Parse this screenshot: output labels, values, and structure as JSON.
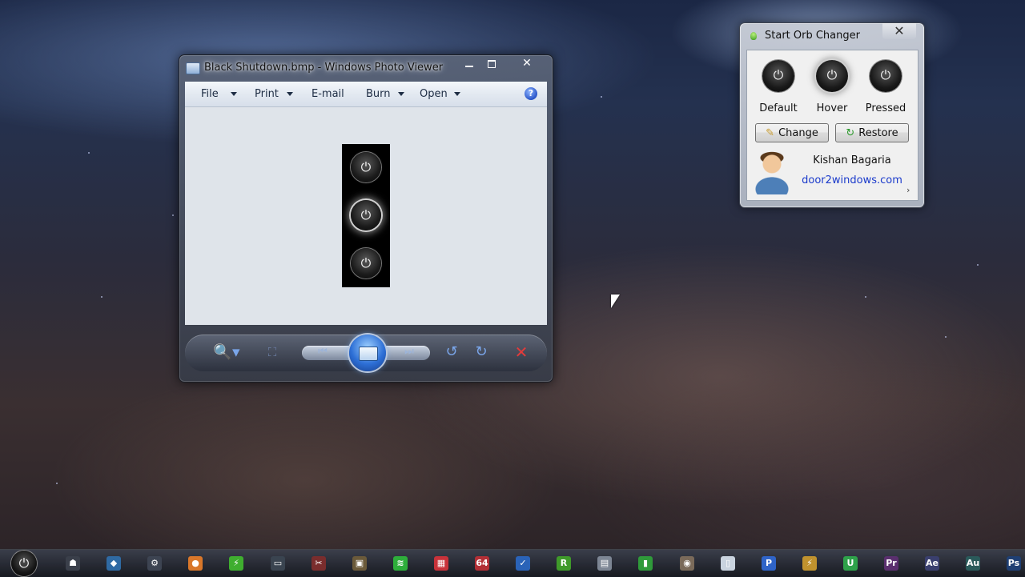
{
  "photo_viewer": {
    "title": "Black Shutdown.bmp - Windows Photo Viewer",
    "caption_buttons": {
      "minimize": "",
      "maximize": "",
      "close": "✕"
    },
    "menu": [
      {
        "label": "File",
        "has_dropdown": true
      },
      {
        "label": "Print",
        "has_dropdown": true
      },
      {
        "label": "E-mail",
        "has_dropdown": false
      },
      {
        "label": "Burn",
        "has_dropdown": true
      },
      {
        "label": "Open",
        "has_dropdown": true
      }
    ],
    "help_label": "?",
    "image_orbs": [
      "⏻",
      "⏻",
      "⏻"
    ],
    "controls": {
      "zoom": "🔍▾",
      "fit": "⛶",
      "previous": "⏮",
      "next": "⏭",
      "rotate_left": "↺",
      "rotate_right": "↻",
      "delete": "✕"
    }
  },
  "orb_changer": {
    "title": "Start Orb Changer",
    "close": "✕",
    "states": [
      {
        "label": "Default",
        "glyph": "⏻"
      },
      {
        "label": "Hover",
        "glyph": "⏻"
      },
      {
        "label": "Pressed",
        "glyph": "⏻"
      }
    ],
    "change_label": "Change",
    "restore_label": "Restore",
    "author": "Kishan Bagaria",
    "link": "door2windows.com",
    "chevron": "›"
  },
  "taskbar": {
    "start_glyph": "⏻",
    "icons": [
      {
        "name": "app-1-icon",
        "color": "#3a3f4a",
        "glyph": "☗"
      },
      {
        "name": "app-2-icon",
        "color": "#2f6aa3",
        "glyph": "◆"
      },
      {
        "name": "steam-icon",
        "color": "#3d4452",
        "glyph": "⚙"
      },
      {
        "name": "basketball-icon",
        "color": "#d9772a",
        "glyph": "●"
      },
      {
        "name": "app-5-icon",
        "color": "#3fae2f",
        "glyph": "⚡"
      },
      {
        "name": "app-6-icon",
        "color": "#3a4450",
        "glyph": "▭"
      },
      {
        "name": "app-7-icon",
        "color": "#7a2d2d",
        "glyph": "✂"
      },
      {
        "name": "app-8-icon",
        "color": "#6b5a3a",
        "glyph": "▣"
      },
      {
        "name": "app-9-icon",
        "color": "#2eae3b",
        "glyph": "≋"
      },
      {
        "name": "app-10-icon",
        "color": "#c8323a",
        "glyph": "▦"
      },
      {
        "name": "app-11-icon",
        "color": "#b22f36",
        "glyph": "64"
      },
      {
        "name": "app-12-icon",
        "color": "#2a63b8",
        "glyph": "✓"
      },
      {
        "name": "app-13-icon",
        "color": "#3f9a2a",
        "glyph": "R"
      },
      {
        "name": "app-14-icon",
        "color": "#7d8694",
        "glyph": "▤"
      },
      {
        "name": "app-15-icon",
        "color": "#2f9a3a",
        "glyph": "▮"
      },
      {
        "name": "app-16-icon",
        "color": "#7a6a5a",
        "glyph": "◉"
      },
      {
        "name": "app-17-icon",
        "color": "#c9d3df",
        "glyph": "▯"
      },
      {
        "name": "app-18-icon",
        "color": "#2f64c8",
        "glyph": "P"
      },
      {
        "name": "app-19-icon",
        "color": "#c0922e",
        "glyph": "⚡"
      },
      {
        "name": "app-20-icon",
        "color": "#2ea24a",
        "glyph": "U"
      },
      {
        "name": "premiere-icon",
        "color": "#5a2f6e",
        "glyph": "Pr"
      },
      {
        "name": "aftereffects-icon",
        "color": "#3a3f6e",
        "glyph": "Ae"
      },
      {
        "name": "audition-icon",
        "color": "#2a5a5a",
        "glyph": "Au"
      },
      {
        "name": "photoshop-icon",
        "color": "#1f3f73",
        "glyph": "Ps"
      }
    ]
  }
}
